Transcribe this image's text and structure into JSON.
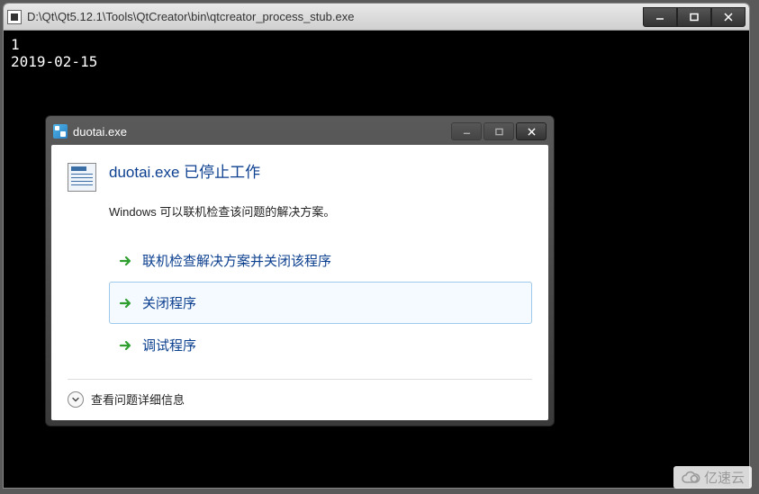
{
  "console": {
    "title": "D:\\Qt\\Qt5.12.1\\Tools\\QtCreator\\bin\\qtcreator_process_stub.exe",
    "lines": [
      "1",
      "2019-02-15"
    ]
  },
  "dialog": {
    "title": "duotai.exe",
    "error_heading": "duotai.exe 已停止工作",
    "subtext": "Windows 可以联机检查该问题的解决方案。",
    "actions": [
      {
        "label": "联机检查解决方案并关闭该程序",
        "highlighted": false
      },
      {
        "label": "关闭程序",
        "highlighted": true
      },
      {
        "label": "调试程序",
        "highlighted": false
      }
    ],
    "details_label": "查看问题详细信息"
  },
  "watermark": "亿速云"
}
